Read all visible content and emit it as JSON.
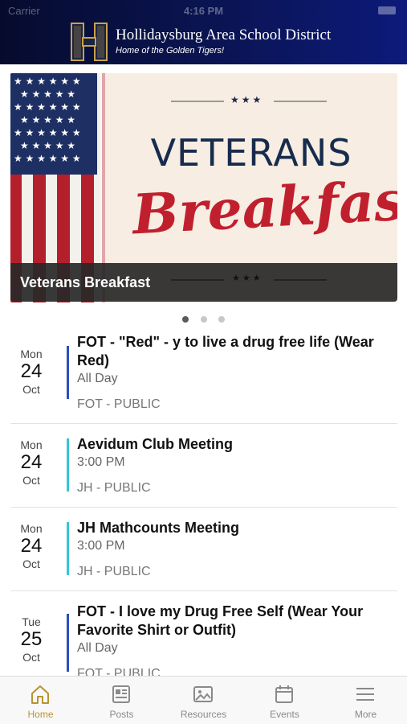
{
  "status_bar": {
    "carrier": "Carrier",
    "time": "4:16 PM"
  },
  "header": {
    "title": "Hollidaysburg Area School District",
    "subtitle": "Home of the Golden Tigers!",
    "logo_letter": "H",
    "logo_color": "#c9a24a"
  },
  "banner": {
    "line1": "VETERANS",
    "line2": "Breakfast",
    "stars": "★★★",
    "caption": "Veterans Breakfast",
    "slide_count": 3,
    "active_slide": 1
  },
  "events": [
    {
      "dow": "Mon",
      "day": "24",
      "month": "Oct",
      "title": "FOT - \"Red\" - y to live a drug free life (Wear Red)",
      "time": "All Day",
      "calendar": "FOT - PUBLIC",
      "color": "#2a4fbf"
    },
    {
      "dow": "Mon",
      "day": "24",
      "month": "Oct",
      "title": "Aevidum Club Meeting",
      "time": "3:00 PM",
      "calendar": "JH - PUBLIC",
      "color": "#35c6d8"
    },
    {
      "dow": "Mon",
      "day": "24",
      "month": "Oct",
      "title": "JH Mathcounts Meeting",
      "time": "3:00 PM",
      "calendar": "JH - PUBLIC",
      "color": "#35c6d8"
    },
    {
      "dow": "Tue",
      "day": "25",
      "month": "Oct",
      "title": "FOT - I love my Drug Free Self (Wear Your Favorite Shirt or Outfit)",
      "time": "All Day",
      "calendar": "FOT - PUBLIC",
      "color": "#2a4fbf"
    }
  ],
  "tabs": [
    {
      "label": "Home",
      "icon": "home-icon",
      "active": true
    },
    {
      "label": "Posts",
      "icon": "posts-icon",
      "active": false
    },
    {
      "label": "Resources",
      "icon": "resources-icon",
      "active": false
    },
    {
      "label": "Events",
      "icon": "events-icon",
      "active": false
    },
    {
      "label": "More",
      "icon": "more-icon",
      "active": false
    }
  ],
  "colors": {
    "accent": "#b8932f",
    "header_dark": "#060b2e",
    "header_light": "#0d1a7a"
  }
}
